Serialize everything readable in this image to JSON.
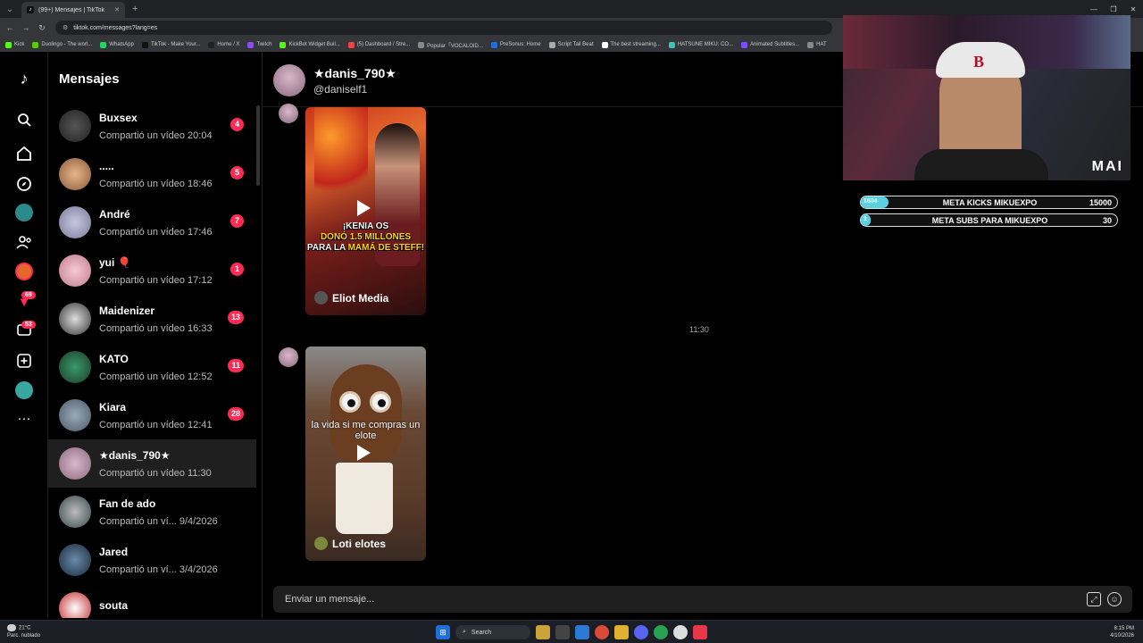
{
  "browser": {
    "tab_title": "(99+) Mensajes | TikTok",
    "url": "tiktok.com/messages?lang=es",
    "bookmarks": [
      "Kick",
      "Duolingo - The worl...",
      "WhatsApp",
      "TikTok - Make Your...",
      "Home / X",
      "Twitch",
      "KickBot Widget Buil...",
      "(5) Dashboard / Stre...",
      "Popular「VOCALOID...",
      "PreSonus: Home",
      "Script Tail Beat",
      "The best streaming...",
      "HATSUNE MIKU: CO...",
      "Animated Subtitles...",
      "HAT"
    ]
  },
  "rail": {
    "badge_inbox": "69",
    "badge_messages": "53"
  },
  "sidebar": {
    "title": "Mensajes",
    "conversations": [
      {
        "name": "Buxsex",
        "sub": "Compartió un vídeo 20:04",
        "count": "4"
      },
      {
        "name": ".....",
        "sub": "Compartió un vídeo 18:46",
        "count": "5"
      },
      {
        "name": "André",
        "sub": "Compartió un vídeo 17:46",
        "count": "7"
      },
      {
        "name": "yui 🎈",
        "sub": "Compartió un vídeo 17:12",
        "count": "1"
      },
      {
        "name": "Maidenizer",
        "sub": "Compartió un vídeo 16:33",
        "count": "13"
      },
      {
        "name": "KATO",
        "sub": "Compartió un vídeo 12:52",
        "count": "11"
      },
      {
        "name": "Kiara",
        "sub": "Compartió un vídeo 12:41",
        "count": "28"
      },
      {
        "name": "★danis_790★",
        "sub": "Compartió un vídeo 11:30",
        "count": ""
      },
      {
        "name": "Fan de ado",
        "sub": "Compartió un ví...  9/4/2026",
        "count": ""
      },
      {
        "name": "Jared",
        "sub": "Compartió un ví...  3/4/2026",
        "count": ""
      },
      {
        "name": "souta",
        "sub": "",
        "count": ""
      }
    ]
  },
  "chat": {
    "name": "★danis_790★",
    "handle": "@daniself1",
    "video1": {
      "overlay_line1": "¡KENIA OS",
      "overlay_line2": "DONÓ 1.5 MILLONES",
      "overlay_line3_a": "PARA LA ",
      "overlay_line3_b": "MAMÁ DE STEFF!",
      "author": "Eliot Media"
    },
    "timestamp": "11:30",
    "video2": {
      "overlay": "la vida si me compras un elote",
      "author": "Loti elotes"
    },
    "input_placeholder": "Enviar un mensaje..."
  },
  "stream_overlay": {
    "logo": "MAI",
    "goal1": {
      "label": "META KICKS MIKUEXPO",
      "current": "1604",
      "goal": "15000",
      "fraction": 0.107
    },
    "goal2": {
      "label": "META SUBS PARA MIKUEXPO",
      "current": "1",
      "goal": "30",
      "fraction": 0.033
    }
  },
  "taskbar": {
    "temp": "21°C",
    "weather": "Parc. nublado",
    "search": "Search",
    "time": "8:15 PM",
    "date": "4/10/2026"
  },
  "colors": {
    "accent": "#fe2c55",
    "goal_fill": "#5ad1e0"
  }
}
